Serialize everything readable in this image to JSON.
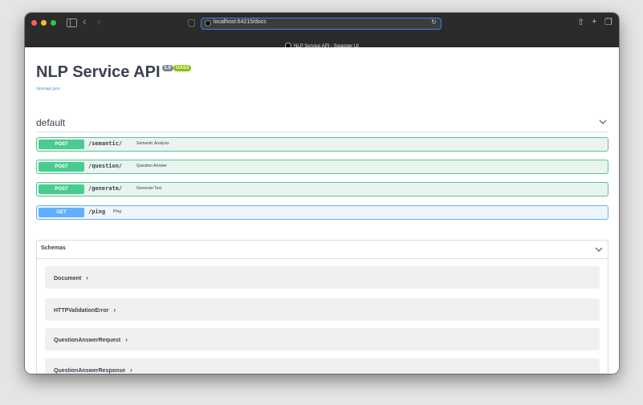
{
  "browser": {
    "url": "localhost:64215/docs",
    "tab_title": "NLP Service API - Swagger UI"
  },
  "api": {
    "title": "NLP Service API",
    "version": "1.0",
    "oas_badge": "OAS3",
    "spec_link": "/openapi.json"
  },
  "tag": {
    "name": "default"
  },
  "operations": [
    {
      "method": "POST",
      "path": "/semantic/",
      "summary": "Semantic Analysis"
    },
    {
      "method": "POST",
      "path": "/question/",
      "summary": "Question Answer"
    },
    {
      "method": "POST",
      "path": "/generate/",
      "summary": "Generate Text"
    },
    {
      "method": "GET",
      "path": "/ping",
      "summary": "Ping"
    }
  ],
  "schemas": {
    "title": "Schemas",
    "items": [
      {
        "name": "Document"
      },
      {
        "name": "HTTPValidationError"
      },
      {
        "name": "QuestionAnswerRequest"
      },
      {
        "name": "QuestionAnswerResponse"
      }
    ]
  },
  "colors": {
    "post": "#49cc90",
    "get": "#61affe",
    "oas": "#89bf04"
  }
}
